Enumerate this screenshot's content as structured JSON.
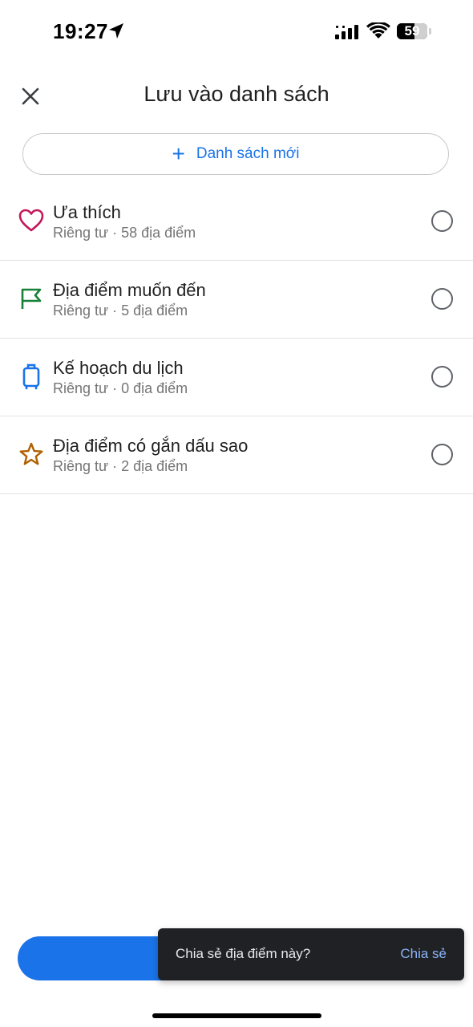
{
  "status_bar": {
    "time": "19:27",
    "battery_text": "59",
    "battery_level": 0.59,
    "icons": [
      "location-arrow-icon",
      "cellular-signal-icon",
      "wifi-icon",
      "battery-icon"
    ]
  },
  "header": {
    "title": "Lưu vào danh sách",
    "close_icon": "close-icon"
  },
  "new_list": {
    "label": "Danh sách mới",
    "icon": "plus-icon",
    "plus_glyph": "+"
  },
  "lists": [
    {
      "title": "Ưa thích",
      "subtitle": "Riêng tư · 58 địa điểm",
      "icon": "heart-icon",
      "icon_color": "#c2185b",
      "selected": false
    },
    {
      "title": "Địa điểm muốn đến",
      "subtitle": "Riêng tư · 5 địa điểm",
      "icon": "flag-icon",
      "icon_color": "#188038",
      "selected": false
    },
    {
      "title": "Kế hoạch du lịch",
      "subtitle": "Riêng tư · 0 địa điểm",
      "icon": "suitcase-icon",
      "icon_color": "#1a73e8",
      "selected": false
    },
    {
      "title": "Địa điểm có gắn dấu sao",
      "subtitle": "Riêng tư · 2 địa điểm",
      "icon": "star-icon",
      "icon_color": "#b06000",
      "selected": false
    }
  ],
  "snackbar": {
    "message": "Chia sẻ địa điểm này?",
    "action": "Chia sẻ"
  },
  "colors": {
    "accent": "#1a73e8",
    "snackbar_bg": "#202124",
    "snackbar_action": "#8ab4f8"
  }
}
